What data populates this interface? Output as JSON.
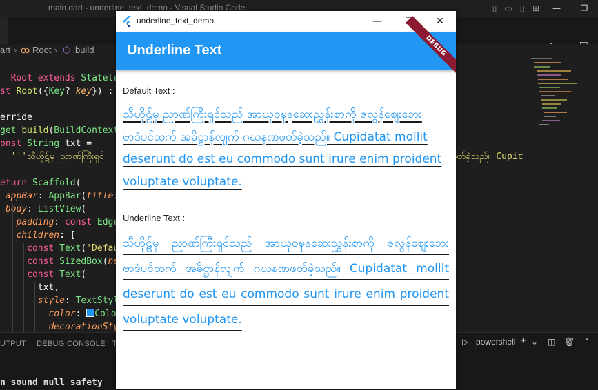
{
  "vscode": {
    "window_title": "main.dart - underline_text_demo - Visual Studio Code",
    "breadcrumb": [
      "art",
      "Root",
      "build"
    ],
    "panel_tabs": [
      "UTPUT",
      "DEBUG CONSOLE",
      "T"
    ],
    "terminal_name": "powershell",
    "terminal_line": "n sound null safety",
    "code_lines": [
      "  Root extends Statele",
      "st Root({Key? key}) :",
      "",
      "erride",
      "get build(BuildContext",
      "onst String txt =",
      "  '''သီဟိုဠ်မှ ညာဏ်ကြီးရှင်",
      "",
      "eturn Scaffold(",
      " appBar: AppBar(title:",
      " body: ListView(",
      "   padding: const Edge",
      "   children: [",
      "     const Text('Defau",
      "     const SizedBox(he",
      "     const Text(",
      "       txt,",
      "       style: TextStyl",
      "         color: Colo",
      "         decorationSty"
    ],
    "code_overflow": "ဖတ်ခဲ့သည်။ Cupic"
  },
  "app": {
    "window_title": "underline_text_demo",
    "appbar_title": "Underline Text",
    "debug_label": "DEBUG",
    "default_label": "Default Text :",
    "underline_label": "Underline Text :",
    "body_text": "သီဟိုဠ်မှ ညာဏ်ကြီးရှင်သည် အာယုဝဍ္ဎနဆေးညွှန်းစာကို ဇလွန်ဈေးဘေး ဗာဒံပင်ထက် အဓိဋ္ဌာန်လျက် ဂဃနဏဖတ်ခဲ့သည်။ Cupidatat mollit deserunt do est eu commodo sunt irure enim proident voluptate voluptate."
  },
  "colors": {
    "appbar": "#2196f3",
    "text_blue": "#2196f3",
    "debug_banner": "#8b1a32"
  }
}
